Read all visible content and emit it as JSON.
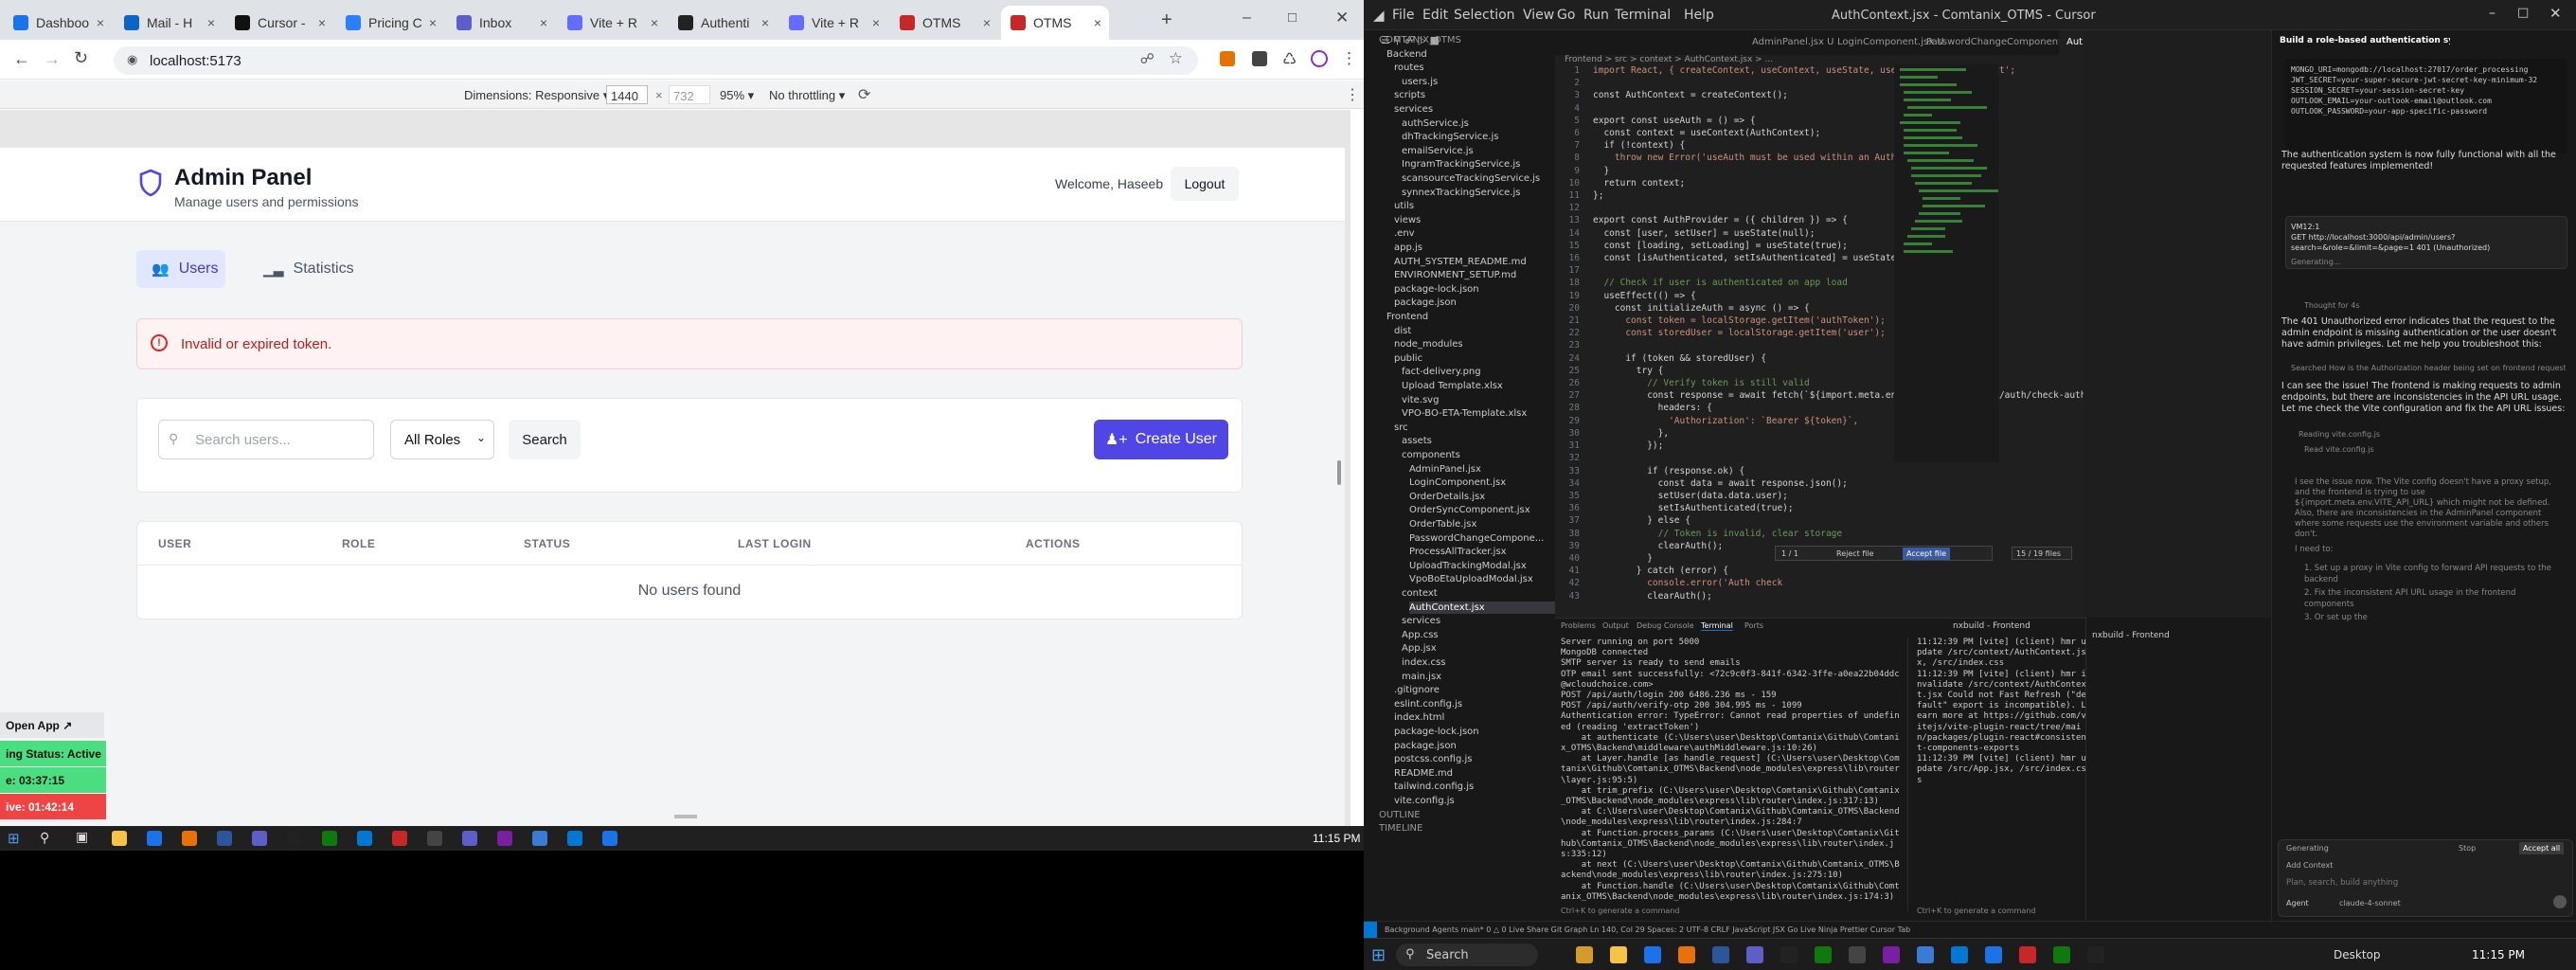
{
  "browser": {
    "tabs": [
      {
        "label": "Dashboo",
        "color": "#1a73e8"
      },
      {
        "label": "Mail - H",
        "color": "#0a66c2"
      },
      {
        "label": "Cursor -",
        "color": "#111111"
      },
      {
        "label": "Pricing C",
        "color": "#2d7ff9"
      },
      {
        "label": "Inbox",
        "color": "#5b5fc7"
      },
      {
        "label": "Vite + R",
        "color": "#646cff"
      },
      {
        "label": "Authenti",
        "color": "#222222"
      },
      {
        "label": "Vite + R",
        "color": "#646cff"
      },
      {
        "label": "OTMS",
        "color": "#c62828"
      },
      {
        "label": "OTMS",
        "color": "#c62828"
      }
    ],
    "new_tab": "+",
    "url": "localhost:5173",
    "devtools": {
      "dimensions_label": "Dimensions: Responsive",
      "width": "1440",
      "height": "732",
      "zoom": "95%",
      "throttle": "No throttling"
    }
  },
  "app": {
    "title": "Admin Panel",
    "subtitle": "Manage users and permissions",
    "welcome": "Welcome, Haseeb",
    "logout": "Logout",
    "tabs": {
      "users": "Users",
      "statistics": "Statistics"
    },
    "error": "Invalid or expired token.",
    "search_placeholder": "Search users...",
    "role_filter": "All Roles",
    "search_button": "Search",
    "create_user": "Create User",
    "columns": [
      "USER",
      "ROLE",
      "STATUS",
      "LAST LOGIN",
      "ACTIONS"
    ],
    "empty": "No users found",
    "accent": "#4f46e5"
  },
  "floating_widget": {
    "open_app": "Open App ↗",
    "tracking": "ing Status: Active",
    "timer1": "e: 03:37:15",
    "timer2": "ive: 01:42:14"
  },
  "left_taskbar": {
    "time": "11:15 PM"
  },
  "ide": {
    "title": "AuthContext.jsx - Comtanix_OTMS - Cursor",
    "menu": [
      "File",
      "Edit",
      "Selection",
      "View",
      "Go",
      "Run",
      "Terminal",
      "Help"
    ],
    "editor_tabs": [
      "AdminPanel.jsx U",
      "LoginComponent.jsx U",
      "PasswordChangeComponent.jsx",
      "AuthContext.jsx U"
    ],
    "breadcrumb": "Frontend > src > context > AuthContext.jsx > ...",
    "explorer": [
      {
        "t": "COMTANIX_OTMS",
        "d": 0
      },
      {
        "t": "Backend",
        "d": 1
      },
      {
        "t": "routes",
        "d": 2
      },
      {
        "t": "users.js",
        "d": 3
      },
      {
        "t": "scripts",
        "d": 2
      },
      {
        "t": "services",
        "d": 2
      },
      {
        "t": "authService.js",
        "d": 3
      },
      {
        "t": "dhTrackingService.js",
        "d": 3
      },
      {
        "t": "emailService.js",
        "d": 3
      },
      {
        "t": "IngramTrackingService.js",
        "d": 3
      },
      {
        "t": "scansourceTrackingService.js",
        "d": 3
      },
      {
        "t": "synnexTrackingService.js",
        "d": 3
      },
      {
        "t": "utils",
        "d": 2
      },
      {
        "t": "views",
        "d": 2
      },
      {
        "t": ".env",
        "d": 2
      },
      {
        "t": "app.js",
        "d": 2
      },
      {
        "t": "AUTH_SYSTEM_README.md",
        "d": 2
      },
      {
        "t": "ENVIRONMENT_SETUP.md",
        "d": 2
      },
      {
        "t": "package-lock.json",
        "d": 2
      },
      {
        "t": "package.json",
        "d": 2
      },
      {
        "t": "Frontend",
        "d": 1
      },
      {
        "t": "dist",
        "d": 2
      },
      {
        "t": "node_modules",
        "d": 2
      },
      {
        "t": "public",
        "d": 2
      },
      {
        "t": "fact-delivery.png",
        "d": 3
      },
      {
        "t": "Upload Template.xlsx",
        "d": 3
      },
      {
        "t": "vite.svg",
        "d": 3
      },
      {
        "t": "VPO-BO-ETA-Template.xlsx",
        "d": 3
      },
      {
        "t": "src",
        "d": 2
      },
      {
        "t": "assets",
        "d": 3
      },
      {
        "t": "components",
        "d": 3
      },
      {
        "t": "AdminPanel.jsx",
        "d": 4
      },
      {
        "t": "LoginComponent.jsx",
        "d": 4
      },
      {
        "t": "OrderDetails.jsx",
        "d": 4
      },
      {
        "t": "OrderSyncComponent.jsx",
        "d": 4
      },
      {
        "t": "OrderTable.jsx",
        "d": 4
      },
      {
        "t": "PasswordChangeCompone...",
        "d": 4
      },
      {
        "t": "ProcessAllTracker.jsx",
        "d": 4
      },
      {
        "t": "UploadTrackingModal.jsx",
        "d": 4
      },
      {
        "t": "VpoBoEtaUploadModal.jsx",
        "d": 4
      },
      {
        "t": "context",
        "d": 3
      },
      {
        "t": "AuthContext.jsx",
        "d": 4
      },
      {
        "t": "services",
        "d": 3
      },
      {
        "t": "App.css",
        "d": 3
      },
      {
        "t": "App.jsx",
        "d": 3
      },
      {
        "t": "index.css",
        "d": 3
      },
      {
        "t": "main.jsx",
        "d": 3
      },
      {
        "t": ".gitignore",
        "d": 2
      },
      {
        "t": "eslint.config.js",
        "d": 2
      },
      {
        "t": "index.html",
        "d": 2
      },
      {
        "t": "package-lock.json",
        "d": 2
      },
      {
        "t": "package.json",
        "d": 2
      },
      {
        "t": "postcss.config.js",
        "d": 2
      },
      {
        "t": "README.md",
        "d": 2
      },
      {
        "t": "tailwind.config.js",
        "d": 2
      },
      {
        "t": "vite.config.js",
        "d": 2
      },
      {
        "t": "OUTLINE",
        "d": 0
      },
      {
        "t": "TIMELINE",
        "d": 0
      }
    ],
    "code": [
      "import React, { createContext, useContext, useState, useEffect } from 'react';",
      "",
      "const AuthContext = createContext();",
      "",
      "export const useAuth = () => {",
      "  const context = useContext(AuthContext);",
      "  if (!context) {",
      "    throw new Error('useAuth must be used within an AuthProvider');",
      "  }",
      "  return context;",
      "};",
      "",
      "export const AuthProvider = ({ children }) => {",
      "  const [user, setUser] = useState(null);",
      "  const [loading, setLoading] = useState(true);",
      "  const [isAuthenticated, setIsAuthenticated] = useState(false);",
      "",
      "  // Check if user is authenticated on app load",
      "  useEffect(() => {",
      "    const initializeAuth = async () => {",
      "      const token = localStorage.getItem('authToken');",
      "      const storedUser = localStorage.getItem('user');",
      "",
      "      if (token && storedUser) {",
      "        try {",
      "          // Verify token is still valid",
      "          const response = await fetch(`${import.meta.env.VITE_API_URL}/api/auth/check-auth`, {",
      "            headers: {",
      "              'Authorization': `Bearer ${token}`,",
      "            },",
      "          });",
      "",
      "          if (response.ok) {",
      "            const data = await response.json();",
      "            setUser(data.data.user);",
      "            setIsAuthenticated(true);",
      "          } else {",
      "            // Token is invalid, clear storage",
      "            clearAuth();",
      "          }",
      "        } catch (error) {",
      "          console.error('Auth check",
      "          clearAuth();"
    ],
    "find_widget": {
      "count": "1 / 1",
      "reject": "Reject file",
      "accept": "Accept file",
      "files": "15 / 19 files"
    },
    "panel_tabs": [
      "Problems",
      "Output",
      "Debug Console",
      "Terminal",
      "Ports"
    ],
    "terminal_name": "nxbuild - Frontend",
    "terminal_left": "Server running on port 5000\nMongoDB connected\nSMTP server is ready to send emails\nOTP email sent successfully: <72c9c0f3-841f-6342-3ffe-a0ea22b04ddc@wcloudchoice.com>\nPOST /api/auth/login 200 6486.236 ms - 159\nPOST /api/auth/verify-otp 200 304.995 ms - 1099\nAuthentication error: TypeError: Cannot read properties of undefined (reading 'extractToken')\n    at authenticate (C:\\Users\\user\\Desktop\\Comtanix\\Github\\Comtanix_OTMS\\Backend\\middleware\\authMiddleware.js:10:26)\n    at Layer.handle [as handle_request] (C:\\Users\\user\\Desktop\\Comtanix\\Github\\Comtanix_OTMS\\Backend\\node_modules\\express\\lib\\router\\layer.js:95:5)\n    at trim_prefix (C:\\Users\\user\\Desktop\\Comtanix\\Github\\Comtanix_OTMS\\Backend\\node_modules\\express\\lib\\router\\index.js:317:13)\n    at C:\\Users\\user\\Desktop\\Comtanix\\Github\\Comtanix_OTMS\\Backend\\node_modules\\express\\lib\\router\\index.js:284:7\n    at Function.process_params (C:\\Users\\user\\Desktop\\Comtanix\\Github\\Comtanix_OTMS\\Backend\\node_modules\\express\\lib\\router\\index.js:335:12)\n    at next (C:\\Users\\user\\Desktop\\Comtanix\\Github\\Comtanix_OTMS\\Backend\\node_modules\\express\\lib\\router\\index.js:275:10)\n    at Function.handle (C:\\Users\\user\\Desktop\\Comtanix\\Github\\Comtanix_OTMS\\Backend\\node_modules\\express\\lib\\router\\index.js:174:3)",
    "terminal_right": "11:12:39 PM [vite] (client) hmr update /src/context/AuthContext.jsx, /src/index.css\n11:12:39 PM [vite] (client) hmr invalidate /src/context/AuthContext.jsx Could not Fast Refresh (\"default\" export is incompatible). Learn more at https://github.com/vitejs/vite-plugin-react/tree/main/packages/plugin-react#consistent-components-exports\n11:12:39 PM [vite] (client) hmr update /src/App.jsx, /src/index.css",
    "terminal_hint": "Ctrl+K to generate a command",
    "chat": {
      "header": "Build a role-based authentication sys",
      "env_lines": "MONGO_URI=mongodb://localhost:27017/order_processing\nJWT_SECRET=your-super-secure-jwt-secret-key-minimum-32\nSESSION_SECRET=your-session-secret-key\nOUTLOOK_EMAIL=your-outlook-email@outlook.com\nOUTLOOK_PASSWORD=your-app-specific-password",
      "p1": "The authentication system is now fully functional with all the requested features implemented!",
      "error_head": "VM12:1",
      "error_line": "GET http://localhost:3000/api/admin/users?search=&role=&limit=&page=1 401 (Unauthorized)",
      "generating": "Generating...",
      "thought": "Thought for 4s",
      "p2": "The 401 Unauthorized error indicates that the request to the admin endpoint is missing authentication or the user doesn't have admin privileges. Let me help you troubleshoot this:",
      "searched": "Searched  How is the Authorization header being set on frontend requests",
      "p3": "I can see the issue! The frontend is making requests to admin endpoints, but there are inconsistencies in the API URL usage. Let me check the Vite configuration and fix the API URL issues:",
      "reading": "Reading  vite.config.js",
      "read": "Read  vite.config.js",
      "p4": "I see the issue now. The Vite config doesn't have a proxy setup, and the frontend is trying to use ${import.meta.env.VITE_API_URL} which might not be defined. Also, there are inconsistencies in the AdminPanel component where some requests use the environment variable and others don't.",
      "need": "I need to:",
      "steps": [
        "1. Set up a proxy in Vite config to forward API requests to the backend",
        "2. Fix the inconsistent API URL usage in the frontend components",
        "3. Or set up the"
      ],
      "gen2": "Generating",
      "stop": "Stop",
      "accept_all": "Accept all",
      "add_context": "Add Context",
      "input_placeholder": "Plan, search, build anything",
      "agent": "Agent",
      "model": "claude-4-sonnet"
    },
    "statusbar": "Background Agents   main*   0 △ 0   Live Share   Git Graph   Ln 140, Col 29   Spaces: 2   UTF-8   CRLF   JavaScript JSX   Go Live   Ninja   Prettier   Cursor Tab",
    "search": "Search",
    "time": "11:15 PM",
    "desktop": "Desktop"
  }
}
